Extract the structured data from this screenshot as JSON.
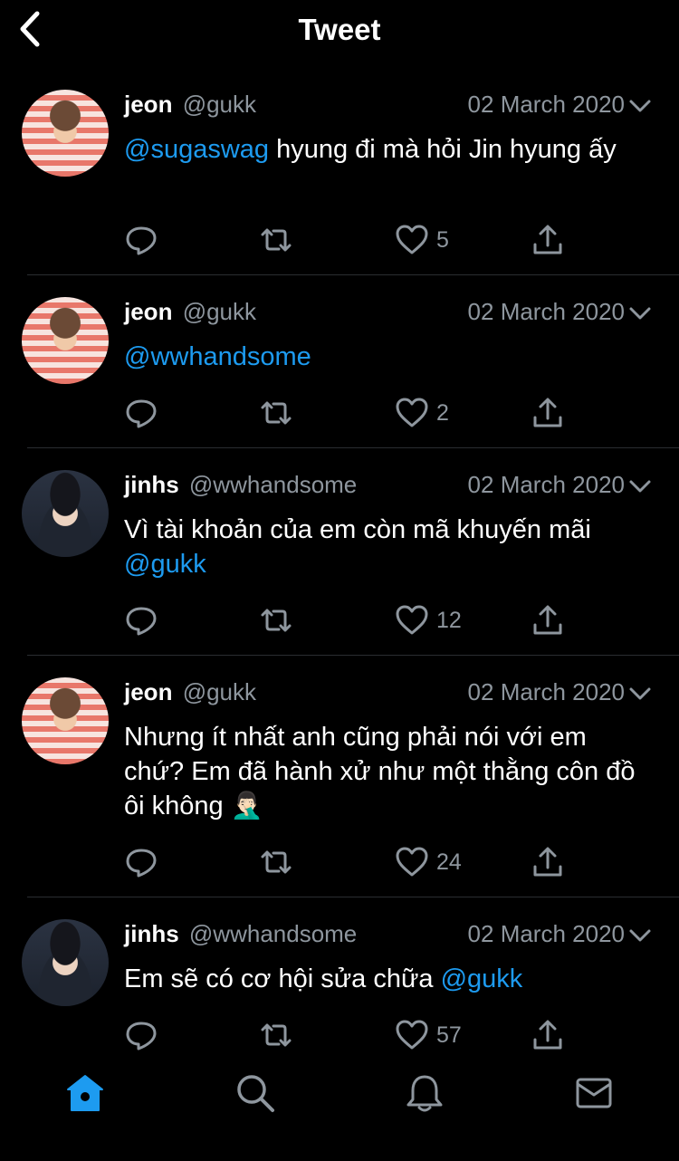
{
  "header": {
    "title": "Tweet"
  },
  "tweets": [
    {
      "name": "jeon",
      "handle": "@gukk",
      "date": "02 March 2020",
      "mention_before": "@sugaswag",
      "text": " hyung đi mà hỏi Jin hyung ấy",
      "mention_after": "",
      "likes": "5",
      "avatar": "jeon"
    },
    {
      "name": "jeon",
      "handle": "@gukk",
      "date": "02 March 2020",
      "mention_before": "@wwhandsome",
      "text": "",
      "mention_after": "",
      "likes": "2",
      "avatar": "jeon"
    },
    {
      "name": "jinhs",
      "handle": "@wwhandsome",
      "date": "02 March 2020",
      "mention_before": "",
      "text": "Vì tài khoản của em còn mã khuyến mãi ",
      "mention_after": "@gukk",
      "likes": "12",
      "avatar": "jinhs"
    },
    {
      "name": "jeon",
      "handle": "@gukk",
      "date": "02 March 2020",
      "mention_before": "",
      "text": "Nhưng ít nhất anh cũng phải nói với em chứ? Em đã hành xử như một thằng côn đồ ôi không 🤦🏻‍♂️",
      "mention_after": "",
      "likes": "24",
      "avatar": "jeon"
    },
    {
      "name": "jinhs",
      "handle": "@wwhandsome",
      "date": "02 March 2020",
      "mention_before": "",
      "text": "Em sẽ có cơ hội sửa chữa ",
      "mention_after": "@gukk",
      "likes": "57",
      "avatar": "jinhs"
    }
  ],
  "tabbar": {
    "items": [
      "home-icon",
      "search-icon",
      "notifications-icon",
      "messages-icon"
    ],
    "active": "home-icon"
  },
  "colors": {
    "accent": "#1d9bf0",
    "secondary_text": "#8e969e",
    "background": "#000000"
  }
}
